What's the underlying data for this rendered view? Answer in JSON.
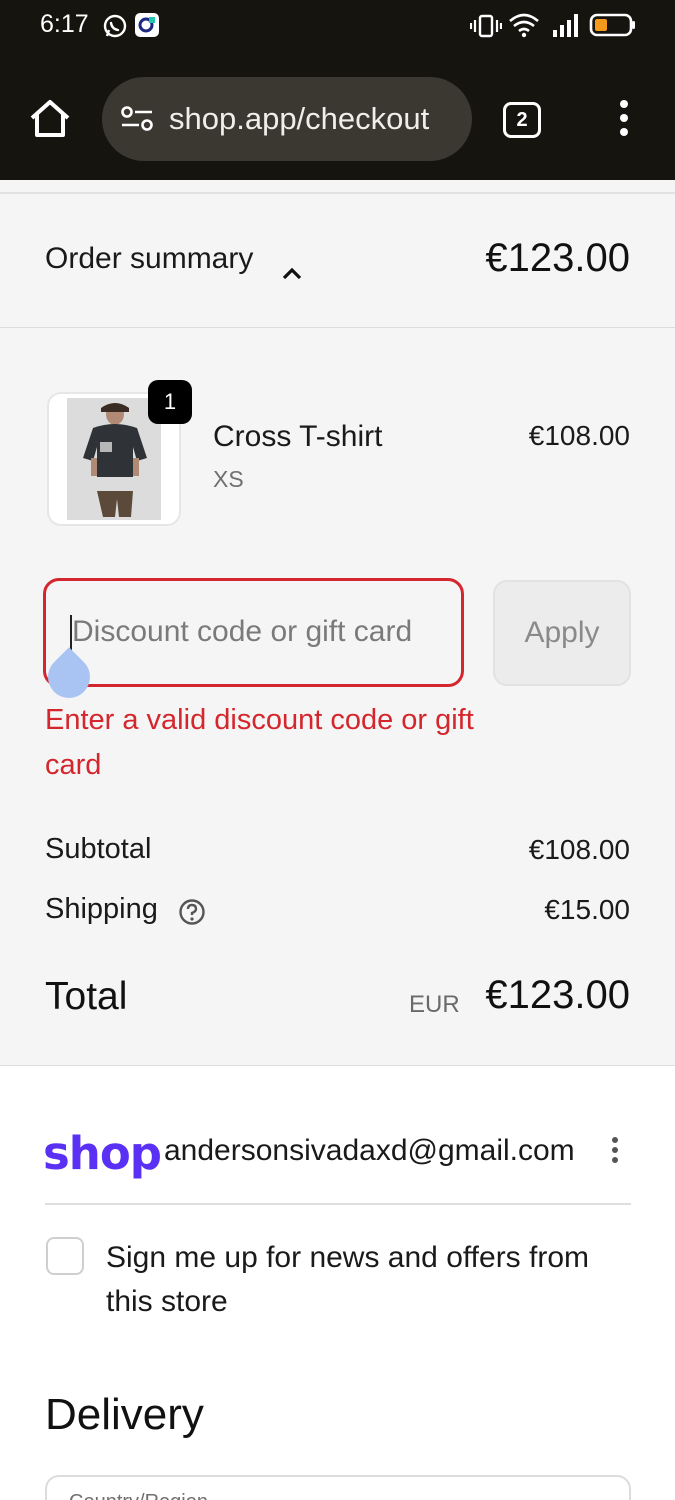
{
  "status_bar": {
    "time": "6:17",
    "icons": [
      "whatsapp-icon",
      "app-notification-icon",
      "vibrate-icon",
      "wifi-icon",
      "signal-icon",
      "battery-low-icon"
    ]
  },
  "browser": {
    "url": "shop.app/checkout",
    "tab_count": "2"
  },
  "order_summary": {
    "label": "Order summary",
    "total": "€123.00",
    "item": {
      "quantity": "1",
      "name": "Cross T-shirt",
      "variant": "XS",
      "price": "€108.00"
    },
    "discount": {
      "placeholder": "Discount code or gift card",
      "value": "",
      "apply_label": "Apply",
      "error": "Enter a valid discount code or gift card"
    },
    "subtotal_label": "Subtotal",
    "subtotal_value": "€108.00",
    "shipping_label": "Shipping",
    "shipping_value": "€15.00",
    "total_label": "Total",
    "currency": "EUR",
    "total_value": "€123.00"
  },
  "account": {
    "logo_text": "shop",
    "email": "andersonsivadaxd@gmail.com"
  },
  "newsletter": {
    "label": "Sign me up for news and offers from this store",
    "checked": false
  },
  "delivery": {
    "heading": "Delivery",
    "country_label": "Country/Region"
  },
  "colors": {
    "error": "#d4262d",
    "shop_brand": "#5a31f4",
    "browser_bar": "#16140f"
  }
}
